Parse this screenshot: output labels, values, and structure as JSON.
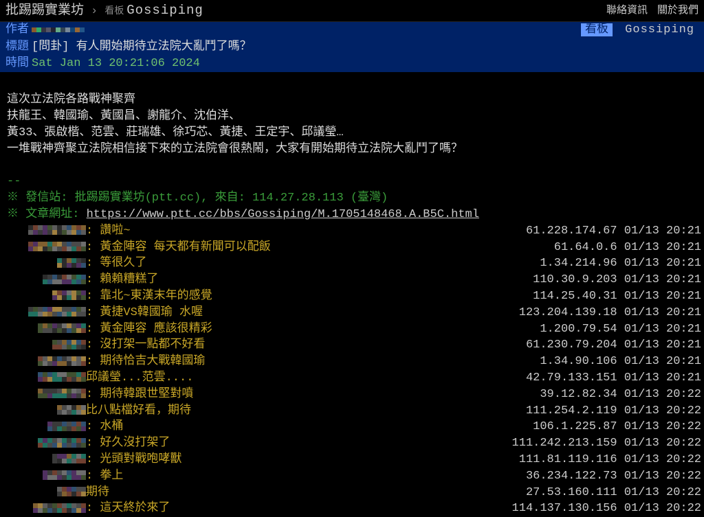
{
  "topbar": {
    "site_name": "批踢踢實業坊",
    "chevron": "›",
    "board_prefix": "看板",
    "board_name": "Gossiping",
    "links": {
      "contact": "聯絡資訊",
      "about": "關於我們"
    }
  },
  "header": {
    "labels": {
      "author": "作者",
      "title": "標題",
      "time": "時間"
    },
    "author_value": "",
    "title_value": "[問卦] 有人開始期待立法院大亂鬥了嗎？",
    "time_value": "Sat Jan 13 20:21:06 2024",
    "board_tag": "看板",
    "board_name": "Gossiping"
  },
  "body_lines": [
    "",
    "這次立法院各路戰神聚齊",
    "扶龍王、韓國瑜、黃國昌、謝龍介、沈伯洋、",
    "黃33、張啟楷、范雲、莊瑞雄、徐巧芯、黃捷、王定宇、邱議瑩…",
    "一堆戰神齊聚立法院相信接下來的立法院會很熱鬧，大家有開始期待立法院大亂鬥了嗎？",
    ""
  ],
  "meta": {
    "dashes": "--",
    "from_line": "※ 發信站: 批踢踢實業坊(ptt.cc), 來自: 114.27.28.113 (臺灣)",
    "url_prefix": "※ 文章網址: ",
    "url": "https://www.ptt.cc/bbs/Gossiping/M.1705148468.A.B5C.html"
  },
  "comments": [
    {
      "content": ": 讚啦~",
      "ip": "61.228.174.67",
      "dt": "01/13 20:21"
    },
    {
      "content": ": 黃金陣容  每天都有新聞可以配飯",
      "ip": "61.64.0.6",
      "dt": "01/13 20:21"
    },
    {
      "content": ": 等很久了",
      "ip": "1.34.214.96",
      "dt": "01/13 20:21"
    },
    {
      "content": ": 賴賴糟糕了",
      "ip": "110.30.9.203",
      "dt": "01/13 20:21"
    },
    {
      "content": ": 靠北~東漢末年的感覺",
      "ip": "114.25.40.31",
      "dt": "01/13 20:21"
    },
    {
      "content": ": 黃捷VS韓國瑜  水喔",
      "ip": "123.204.139.18",
      "dt": "01/13 20:21"
    },
    {
      "content": ": 黃金陣容  應該很精彩",
      "ip": "1.200.79.54",
      "dt": "01/13 20:21"
    },
    {
      "content": ": 沒打架一點都不好看",
      "ip": "61.230.79.204",
      "dt": "01/13 20:21"
    },
    {
      "content": ": 期待恰吉大戰韓國瑜",
      "ip": "1.34.90.106",
      "dt": "01/13 20:21"
    },
    {
      "content": "  邱議瑩...范雲....",
      "ip": "42.79.133.151",
      "dt": "01/13 20:21"
    },
    {
      "content": ": 期待韓跟世堅對噴",
      "ip": "39.12.82.34",
      "dt": "01/13 20:22"
    },
    {
      "content": " 比八點檔好看，期待",
      "ip": "111.254.2.119",
      "dt": "01/13 20:22"
    },
    {
      "content": ": 水桶",
      "ip": "106.1.225.87",
      "dt": "01/13 20:22"
    },
    {
      "content": ": 好久沒打架了",
      "ip": "111.242.213.159",
      "dt": "01/13 20:22"
    },
    {
      "content": ": 光頭對戰咆哮獸",
      "ip": "111.81.119.116",
      "dt": "01/13 20:22"
    },
    {
      "content": ": 拳上",
      "ip": "36.234.122.73",
      "dt": "01/13 20:22"
    },
    {
      "content": "  期待",
      "ip": "27.53.160.111",
      "dt": "01/13 20:22"
    },
    {
      "content": ": 這天終於來了",
      "ip": "114.137.130.156",
      "dt": "01/13 20:22"
    }
  ]
}
